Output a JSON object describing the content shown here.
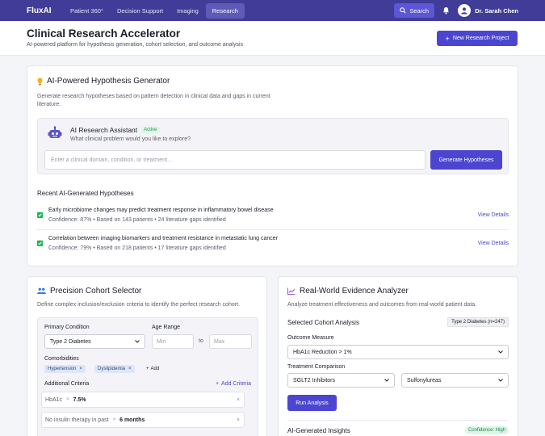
{
  "nav": {
    "logo": "FluxAI",
    "links": [
      {
        "label": "Patient 360°",
        "active": false
      },
      {
        "label": "Decision Support",
        "active": false
      },
      {
        "label": "Imaging",
        "active": false
      },
      {
        "label": "Research",
        "active": true
      }
    ],
    "search_label": "Search",
    "user_name": "Dr. Sarah Chen",
    "icons": {
      "search": "search-icon",
      "bell": "bell-icon",
      "avatar": "user-icon"
    }
  },
  "header": {
    "title": "Clinical Research Accelerator",
    "subtitle": "AI-powered platform for hypothesis generation, cohort selection, and outcome analysis",
    "new_project_label": "New Research Project"
  },
  "hypothesis": {
    "title": "AI-Powered Hypothesis Generator",
    "description": "Generate research hypotheses based on pattern detection in clinical data and gaps in current literature.",
    "assistant": {
      "name": "AI Research Assistant",
      "status": "Active",
      "question": "What clinical problem would you like to explore?",
      "input_placeholder": "Enter a clinical domain, condition, or treatment...",
      "button_label": "Generate Hypotheses"
    },
    "recent_title": "Recent AI-Generated Hypotheses",
    "items": [
      {
        "text": "Early microbiome changes may predict treatment response in inflammatory bowel disease",
        "meta": "Confidence: 87% • Based on 143 patients • 24 literature gaps identified",
        "link": "View Details"
      },
      {
        "text": "Correlation between imaging biomarkers and treatment resistance in metastatic lung cancer",
        "meta": "Confidence: 79% • Based on 218 patients • 17 literature gaps identified",
        "link": "View Details"
      }
    ]
  },
  "cohort": {
    "title": "Precision Cohort Selector",
    "description": "Define complex inclusion/exclusion criteria to identify the perfect research cohort.",
    "primary_condition_label": "Primary Condition",
    "primary_condition_value": "Type 2 Diabetes",
    "age_range_label": "Age Range",
    "age_min_placeholder": "Min",
    "age_to": "to",
    "age_max_placeholder": "Max",
    "comorbidities_label": "Comorbidities",
    "comorbidities": [
      "Hypertension",
      "Dyslipidemia"
    ],
    "add_label": "Add",
    "additional_label": "Additional Criteria",
    "add_criteria_label": "Add Criteria",
    "criteria": [
      {
        "name": "HbA1c",
        "op": ">",
        "value": "7.5%"
      },
      {
        "name": "No insulin therapy in past",
        "op": ">",
        "value": "6 months"
      }
    ]
  },
  "rwe": {
    "title": "Real-World Evidence Analyzer",
    "description": "Analyze treatment effectiveness and outcomes from real-world patient data.",
    "selected_title": "Selected Cohort Analysis",
    "cohort_badge": "Type 2 Diabetes (n=247)",
    "outcome_label": "Outcome Measure",
    "outcome_value": "HbA1c Reduction > 1%",
    "comparison_label": "Treatment Comparison",
    "treatment_a": "SGLT2 Inhibitors",
    "treatment_b": "Sulfonylureas",
    "run_label": "Run Analysis",
    "insights_title": "AI-Generated Insights",
    "confidence_badge": "Confidence: High"
  }
}
